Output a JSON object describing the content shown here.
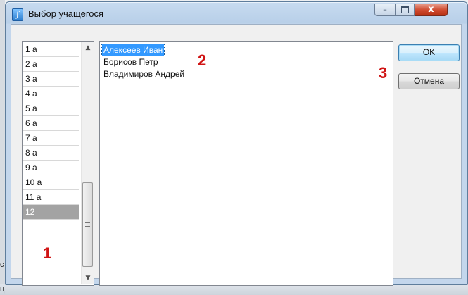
{
  "window": {
    "title": "Выбор учащегося",
    "close_glyph": "x"
  },
  "classes": {
    "items": [
      {
        "label": "1 а"
      },
      {
        "label": "2 а"
      },
      {
        "label": "3 а"
      },
      {
        "label": "4 а"
      },
      {
        "label": "5 а"
      },
      {
        "label": "6 а"
      },
      {
        "label": "7 а"
      },
      {
        "label": "8 а"
      },
      {
        "label": "9 а"
      },
      {
        "label": "10 а"
      },
      {
        "label": "11 а"
      },
      {
        "label": "12"
      }
    ],
    "selected_index": 11
  },
  "students": {
    "items": [
      {
        "label": "Алексеев Иван"
      },
      {
        "label": "Борисов Петр"
      },
      {
        "label": "Владимиров Андрей"
      }
    ],
    "selected_index": 0
  },
  "buttons": {
    "ok_label": "OK",
    "cancel_label": "Отмена"
  },
  "markers": {
    "m1": "1",
    "m2": "2",
    "m3": "3"
  },
  "background": {
    "artifact_top": "с",
    "artifact_bottom": "ц"
  },
  "colors": {
    "selection_blue": "#3399ff",
    "selected_gray": "#a3a3a3",
    "marker_red": "#d01414",
    "close_button_red": "#cf4a2e"
  }
}
